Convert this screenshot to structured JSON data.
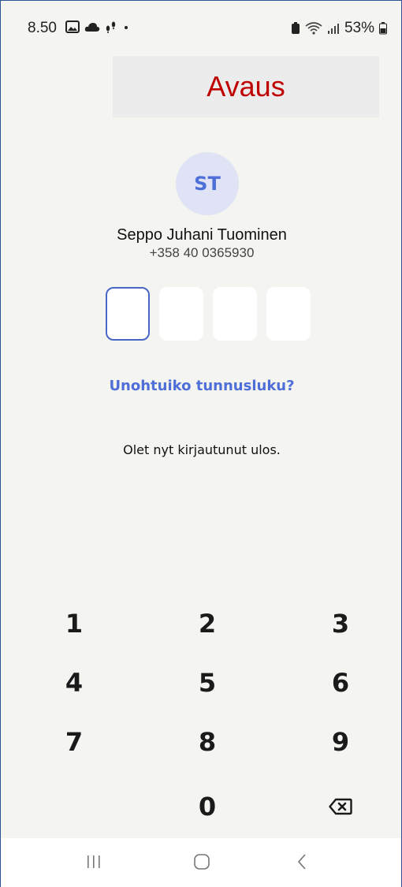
{
  "status_bar": {
    "time": "8.50",
    "battery": "53%"
  },
  "header": {
    "title": "Avaus",
    "title_color": "#c00000"
  },
  "user": {
    "initials": "ST",
    "name": "Seppo Juhani Tuominen",
    "phone": "+358 40 0365930"
  },
  "pin": {
    "length": 4,
    "filled": 0
  },
  "forgot_link": "Unohtuiko tunnusluku?",
  "message": "Olet nyt kirjautunut ulos.",
  "keypad": {
    "k1": "1",
    "k2": "2",
    "k3": "3",
    "k4": "4",
    "k5": "5",
    "k6": "6",
    "k7": "7",
    "k8": "8",
    "k9": "9",
    "k0": "0"
  },
  "colors": {
    "accent": "#4f6fd8",
    "avatar_bg": "#dfe3f5",
    "background": "#f4f4f1"
  },
  "icons": {
    "backspace": "backspace-icon",
    "nav_recent": "recent-apps-icon",
    "nav_home": "home-icon",
    "nav_back": "back-icon"
  }
}
